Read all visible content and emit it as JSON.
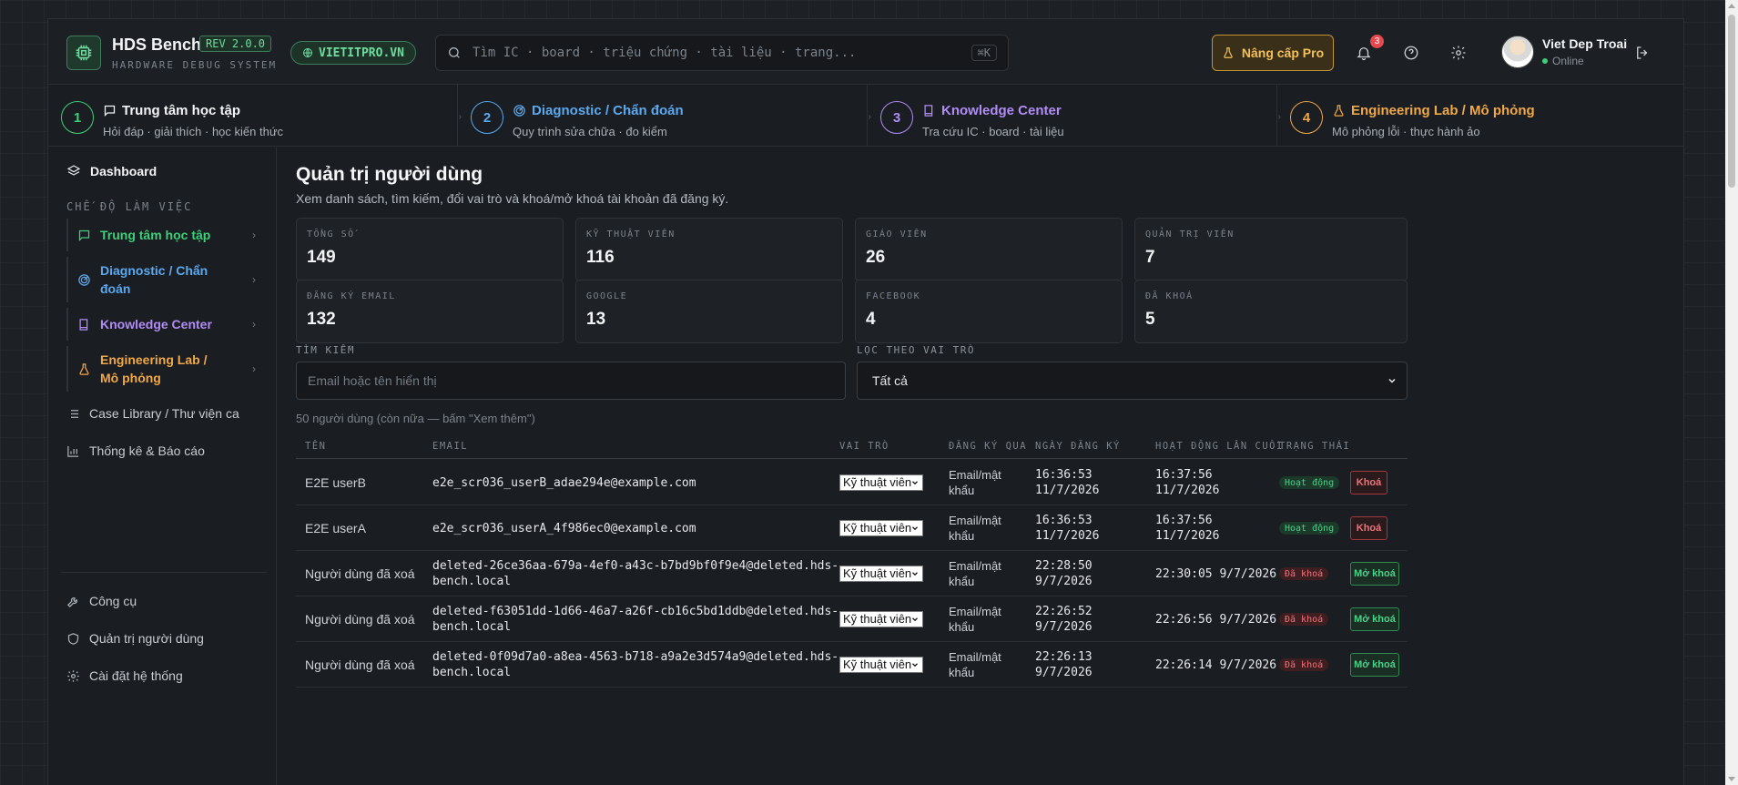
{
  "header": {
    "brand": "HDS Bench",
    "rev": "REV 2.0.0",
    "subtitle": "HARDWARE DEBUG SYSTEM",
    "site": "VIETITPRO.VN",
    "search_placeholder": "Tìm IC · board · triệu chứng · tài liệu · trang...",
    "search_shortcut": "⌘K",
    "upgrade_label": "Nâng cấp Pro",
    "notification_count": "3",
    "user_name": "Viet Dep Troai",
    "user_status": "Online"
  },
  "modules": [
    {
      "num": "1",
      "title": "Trung tâm học tập",
      "sub": "Hỏi đáp · giải thích · học kiến thức",
      "color": "#3ecf7a"
    },
    {
      "num": "2",
      "title": "Diagnostic / Chẩn đoán",
      "sub": "Quy trình sửa chữa · đo kiểm",
      "color": "#5aa9f0"
    },
    {
      "num": "3",
      "title": "Knowledge Center",
      "sub": "Tra cứu IC · board · tài liệu",
      "color": "#b18cf5"
    },
    {
      "num": "4",
      "title": "Engineering Lab / Mô phỏng",
      "sub": "Mô phỏng lỗi · thực hành ảo",
      "color": "#f0a848"
    }
  ],
  "sidebar": {
    "dashboard": "Dashboard",
    "section_label": "CHẾ ĐỘ LÀM VIỆC",
    "modes": [
      "Trung tâm học tập",
      "Diagnostic / Chẩn đoán",
      "Knowledge Center",
      "Engineering Lab / Mô phỏng"
    ],
    "links": [
      "Case Library / Thư viện ca",
      "Thống kê & Báo cáo"
    ],
    "tools": [
      "Công cụ",
      "Quản trị người dùng",
      "Cài đặt hệ thống"
    ]
  },
  "main": {
    "title": "Quản trị người dùng",
    "subtitle": "Xem danh sách, tìm kiếm, đổi vai trò và khoá/mở khoá tài khoản đã đăng ký.",
    "stats": [
      {
        "label": "TỔNG SỐ",
        "value": "149"
      },
      {
        "label": "KỸ THUẬT VIÊN",
        "value": "116"
      },
      {
        "label": "GIÁO VIÊN",
        "value": "26"
      },
      {
        "label": "QUẢN TRỊ VIÊN",
        "value": "7"
      },
      {
        "label": "ĐĂNG KÝ EMAIL",
        "value": "132"
      },
      {
        "label": "GOOGLE",
        "value": "13"
      },
      {
        "label": "FACEBOOK",
        "value": "4"
      },
      {
        "label": "ĐÃ KHOÁ",
        "value": "5"
      }
    ],
    "search_label": "TÌM KIẾM",
    "search_placeholder": "Email hoặc tên hiển thị",
    "filter_label": "LỌC THEO VAI TRÒ",
    "filter_value": "Tất cả",
    "count_text": "50 người dùng (còn nữa — bấm \"Xem thêm\")",
    "columns": [
      "TÊN",
      "EMAIL",
      "VAI TRÒ",
      "ĐĂNG KÝ QUA",
      "NGÀY ĐĂNG KÝ",
      "HOẠT ĐỘNG LẦN CUỐI",
      "TRẠNG THÁI"
    ],
    "rows": [
      {
        "name": "E2E userB",
        "email1": "e2e_scr036_userB_adae294e@example.com",
        "email2": "",
        "role": "Kỹ thuật viên",
        "via1": "Email/mật",
        "via2": "khẩu",
        "reg1": "16:36:53",
        "reg2": "11/7/2026",
        "last1": "16:37:56",
        "last2": "11/7/2026",
        "status": "Hoạt động",
        "action": "Khoá"
      },
      {
        "name": "E2E userA",
        "email1": "e2e_scr036_userA_4f986ec0@example.com",
        "email2": "",
        "role": "Kỹ thuật viên",
        "via1": "Email/mật",
        "via2": "khẩu",
        "reg1": "16:36:53",
        "reg2": "11/7/2026",
        "last1": "16:37:56",
        "last2": "11/7/2026",
        "status": "Hoạt động",
        "action": "Khoá"
      },
      {
        "name": "Người dùng đã xoá",
        "email1": "deleted-26ce36aa-679a-4ef0-a43c-b7bd9bf0f9e4@deleted.hds-",
        "email2": "bench.local",
        "role": "Kỹ thuật viên",
        "via1": "Email/mật",
        "via2": "khẩu",
        "reg1": "22:28:50",
        "reg2": "9/7/2026",
        "last1": "22:30:05 9/7/2026",
        "last2": "",
        "status": "Đã khoá",
        "action": "Mở khoá"
      },
      {
        "name": "Người dùng đã xoá",
        "email1": "deleted-f63051dd-1d66-46a7-a26f-cb16c5bd1ddb@deleted.hds-",
        "email2": "bench.local",
        "role": "Kỹ thuật viên",
        "via1": "Email/mật",
        "via2": "khẩu",
        "reg1": "22:26:52",
        "reg2": "9/7/2026",
        "last1": "22:26:56 9/7/2026",
        "last2": "",
        "status": "Đã khoá",
        "action": "Mở khoá"
      },
      {
        "name": "Người dùng đã xoá",
        "email1": "deleted-0f09d7a0-a8ea-4563-b718-a9a2e3d574a9@deleted.hds-",
        "email2": "bench.local",
        "role": "Kỹ thuật viên",
        "via1": "Email/mật",
        "via2": "khẩu",
        "reg1": "22:26:13",
        "reg2": "9/7/2026",
        "last1": "22:26:14 9/7/2026",
        "last2": "",
        "status": "Đã khoá",
        "action": "Mở khoá"
      }
    ]
  }
}
